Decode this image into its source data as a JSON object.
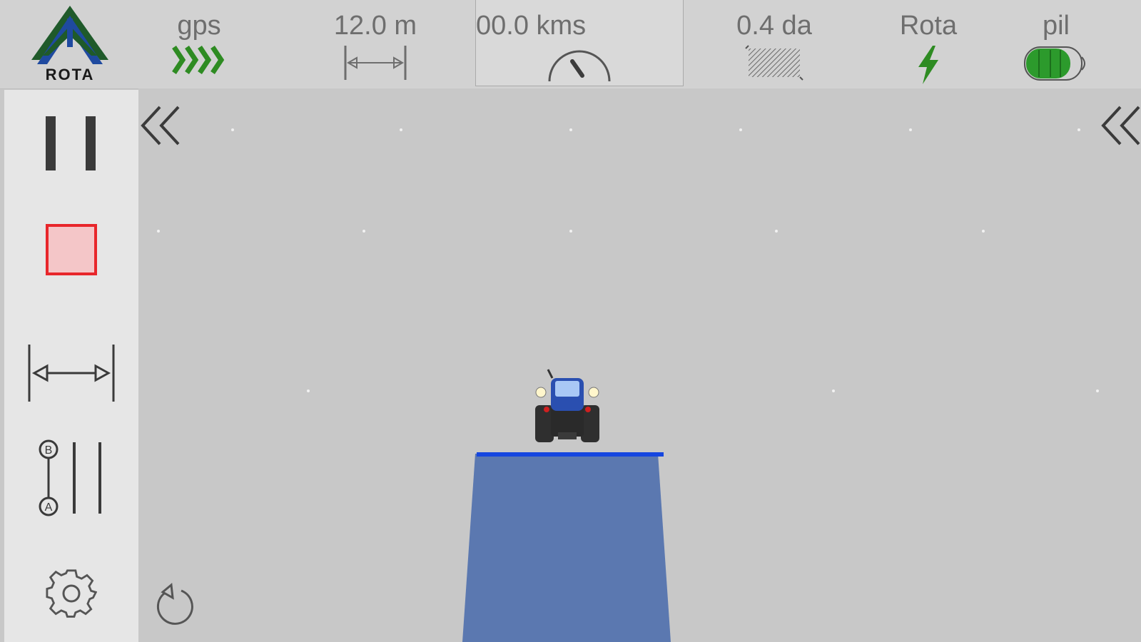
{
  "app": {
    "logo_text": "ROTA"
  },
  "topbar": {
    "gps": {
      "label": "gps",
      "icon": "gps-signal-chevrons-icon"
    },
    "width": {
      "label": "12.0 m",
      "icon": "width-arrows-icon"
    },
    "speed": {
      "label": "00.0 kms",
      "icon": "speedometer-icon"
    },
    "area": {
      "label": "0.4 da",
      "icon": "area-hatched-icon"
    },
    "route": {
      "label": "Rota",
      "icon": "lightning-icon"
    },
    "battery": {
      "label": "pil",
      "icon": "battery-icon"
    }
  },
  "sidebar": {
    "items": [
      {
        "name": "pause-button",
        "icon": "pause-icon"
      },
      {
        "name": "stop-button",
        "icon": "stop-icon"
      },
      {
        "name": "implement-width-button",
        "icon": "width-arrows-icon"
      },
      {
        "name": "ab-line-button",
        "icon": "ab-line-icon"
      },
      {
        "name": "settings-button",
        "icon": "gear-icon"
      }
    ]
  },
  "colors": {
    "gps_green": "#2e8b22",
    "stop_red": "#e8262b",
    "stop_fill": "#f4c6c8",
    "coverage_blue": "#5b78b0",
    "implement_bar": "#1546e0",
    "logo_green": "#1f5a2a",
    "logo_blue": "#1f4aa0",
    "battery_green": "#2c9a2c"
  }
}
